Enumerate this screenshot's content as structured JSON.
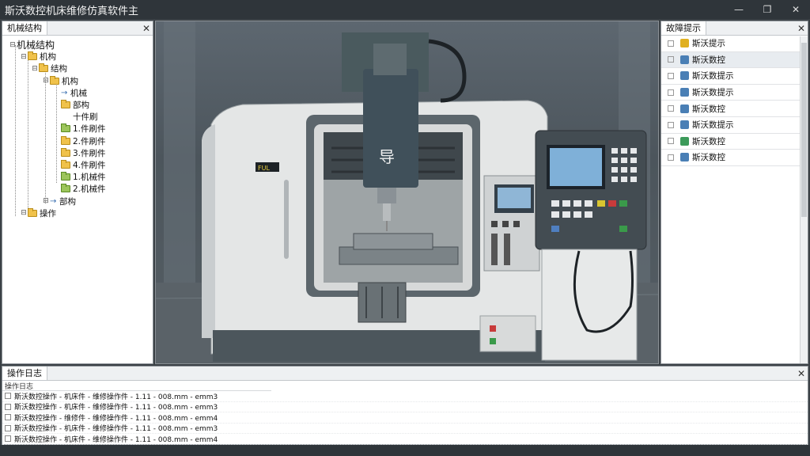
{
  "window": {
    "title": "斯沃数控机床维修仿真软件主",
    "min_icon": "minimize-icon",
    "restore_icon": "restore-icon",
    "close_icon": "close-icon"
  },
  "left_panel": {
    "tab": "机械结构",
    "tree": [
      {
        "label": "机械结构",
        "level": 0,
        "kind": "root"
      },
      {
        "label": "机构",
        "level": 1,
        "kind": "folder"
      },
      {
        "label": "结构",
        "level": 2,
        "kind": "folder"
      },
      {
        "label": "机构",
        "level": 3,
        "kind": "folder"
      },
      {
        "label": "机械",
        "level": 4,
        "kind": "arrow"
      },
      {
        "label": "部构",
        "level": 4,
        "kind": "folder"
      },
      {
        "label": "十件刷",
        "level": 4,
        "kind": "plain"
      },
      {
        "label": "1.件刷件",
        "level": 4,
        "kind": "green"
      },
      {
        "label": "2.件刷件",
        "level": 4,
        "kind": "folder"
      },
      {
        "label": "3.件刷件",
        "level": 4,
        "kind": "folder"
      },
      {
        "label": "4.件刷件",
        "level": 4,
        "kind": "folder"
      },
      {
        "label": "1.机械件",
        "level": 4,
        "kind": "green"
      },
      {
        "label": "2.机械件",
        "level": 4,
        "kind": "green"
      },
      {
        "label": "部构",
        "level": 3,
        "kind": "arrow"
      },
      {
        "label": "操作",
        "level": 1,
        "kind": "folder"
      }
    ]
  },
  "viewport": {
    "spindle_label": "导",
    "badge": "FUL"
  },
  "right_panel": {
    "tab": "故障提示",
    "items": [
      {
        "label": "斯沃提示",
        "color": "#e0b020"
      },
      {
        "label": "斯沃数控",
        "color": "#4a7fb5"
      },
      {
        "label": "斯沃数提示",
        "color": "#4a7fb5"
      },
      {
        "label": "斯沃数提示",
        "color": "#4a7fb5"
      },
      {
        "label": "斯沃数控",
        "color": "#4a7fb5"
      },
      {
        "label": "斯沃数提示",
        "color": "#4a7fb5"
      },
      {
        "label": "斯沃数控",
        "color": "#3c9a5a"
      },
      {
        "label": "斯沃数控",
        "color": "#4a7fb5"
      }
    ]
  },
  "bottom_panel": {
    "tab": "操作日志",
    "subheader": "操作日志",
    "rows": [
      "斯沃数控操作 - 机床件 - 维修操作件 - 1.11 - 008.mm - emm3",
      "斯沃数控操作 - 机床件 - 维修操作件 - 1.11 - 008.mm - emm3",
      "斯沃数控操作 - 维修件 - 维修操作件 - 1.11 - 008.mm - emm4",
      "斯沃数控操作 - 机床件 - 维修操作件 - 1.11 - 008.mm - emm3",
      "斯沃数控操作 - 机床件 - 维修操作件 - 1.11 - 008.mm - emm4"
    ]
  }
}
